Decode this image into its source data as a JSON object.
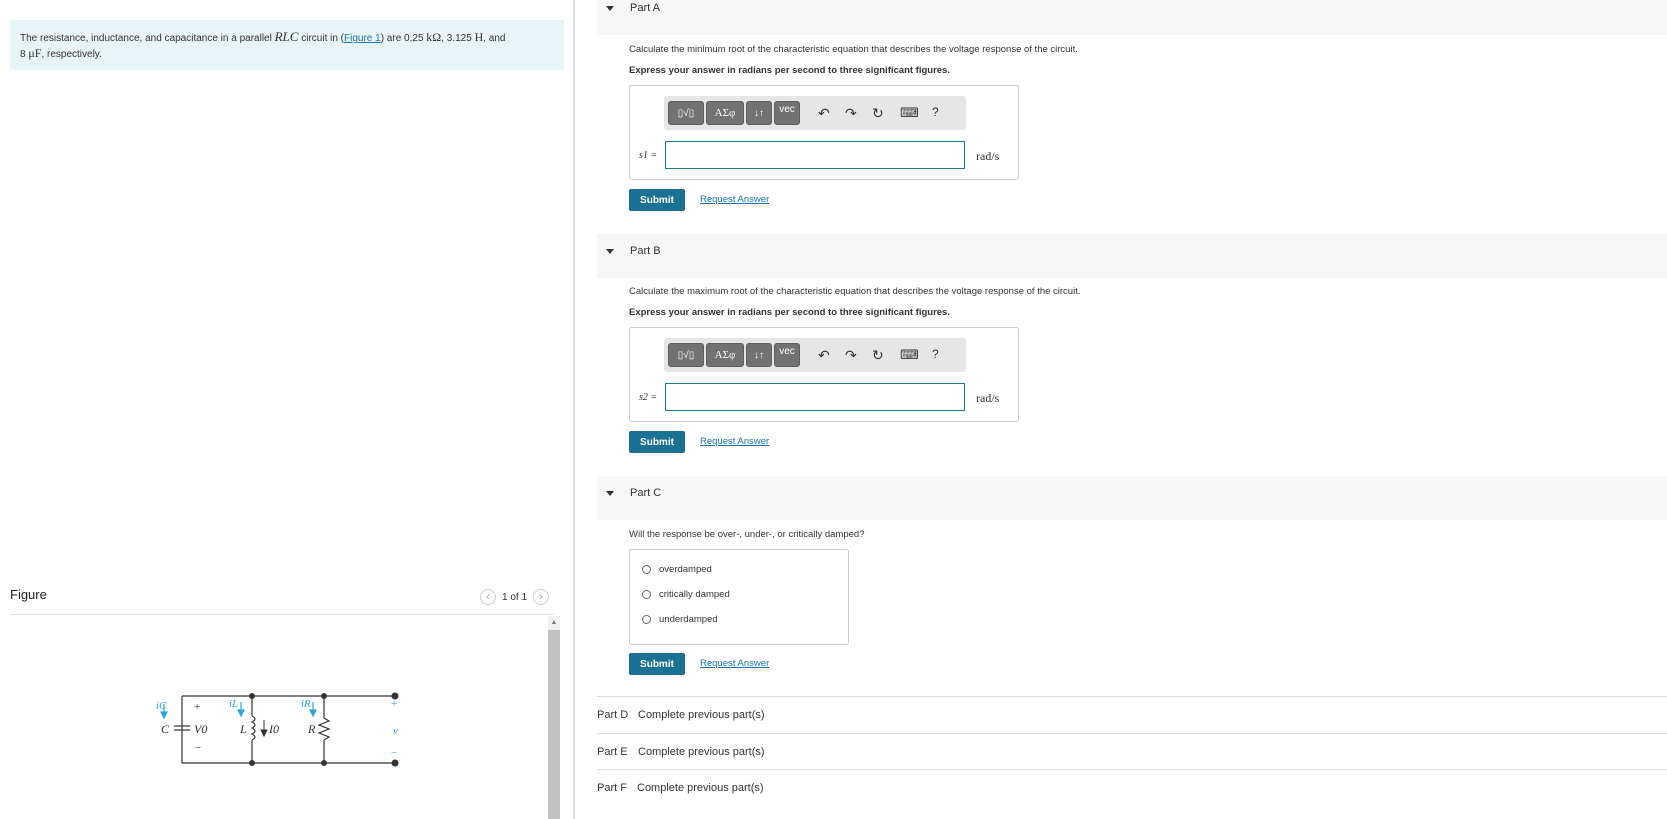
{
  "problem": {
    "text_1": "The resistance, inductance, and capacitance in a parallel ",
    "rlc": "RLC",
    "text_2": " circuit in (",
    "figure_link": "Figure 1",
    "text_3": ") are 0.25 ",
    "kohm": "kΩ",
    "text_4": ", 3.125 ",
    "henry": "H",
    "text_5": ", and",
    "cap_value": "8 ",
    "microfarad": "μF",
    "text_6": ", respectively."
  },
  "figure": {
    "title": "Figure",
    "pager": "1 of 1",
    "labels": {
      "iC": "iC",
      "iL": "iL",
      "iR": "iR",
      "C": "C",
      "L": "L",
      "R": "R",
      "V0": "V0",
      "I0": "I0",
      "plus": "+",
      "minus": "−",
      "v": "v"
    }
  },
  "parts": {
    "a": {
      "label": "Part A",
      "question": "Calculate the minimum root of the characteristic equation that describes the voltage response of the circuit.",
      "instruction": "Express your answer in radians per second to three significant figures.",
      "variable": "s1 =",
      "unit": "rad/s",
      "submit": "Submit",
      "request": "Request Answer"
    },
    "b": {
      "label": "Part B",
      "question": "Calculate the maximum root of the characteristic equation that describes the voltage response of the circuit.",
      "instruction": "Express your answer in radians per second to three significant figures.",
      "variable": "s2 =",
      "unit": "rad/s",
      "submit": "Submit",
      "request": "Request Answer"
    },
    "c": {
      "label": "Part C",
      "question": "Will the response be over-, under-, or critically damped?",
      "options": [
        "overdamped",
        "critically damped",
        "underdamped"
      ],
      "submit": "Submit",
      "request": "Request Answer"
    },
    "locked": [
      {
        "label": "Part D",
        "message": "Complete previous part(s)"
      },
      {
        "label": "Part E",
        "message": "Complete previous part(s)"
      },
      {
        "label": "Part F",
        "message": "Complete previous part(s)"
      }
    ]
  },
  "toolbar": {
    "templates": "▯√▯",
    "greek": "ΑΣφ",
    "arrows": "↓↑",
    "vec": "vec",
    "undo": "↶",
    "redo": "↷",
    "reset": "↻",
    "keyboard": "⌨",
    "help": "?"
  },
  "colors": {
    "accent": "#1a7194",
    "problem_bg": "#e7f5f6",
    "link": "#1a73a8",
    "current_arrow": "#2aa7d8"
  }
}
